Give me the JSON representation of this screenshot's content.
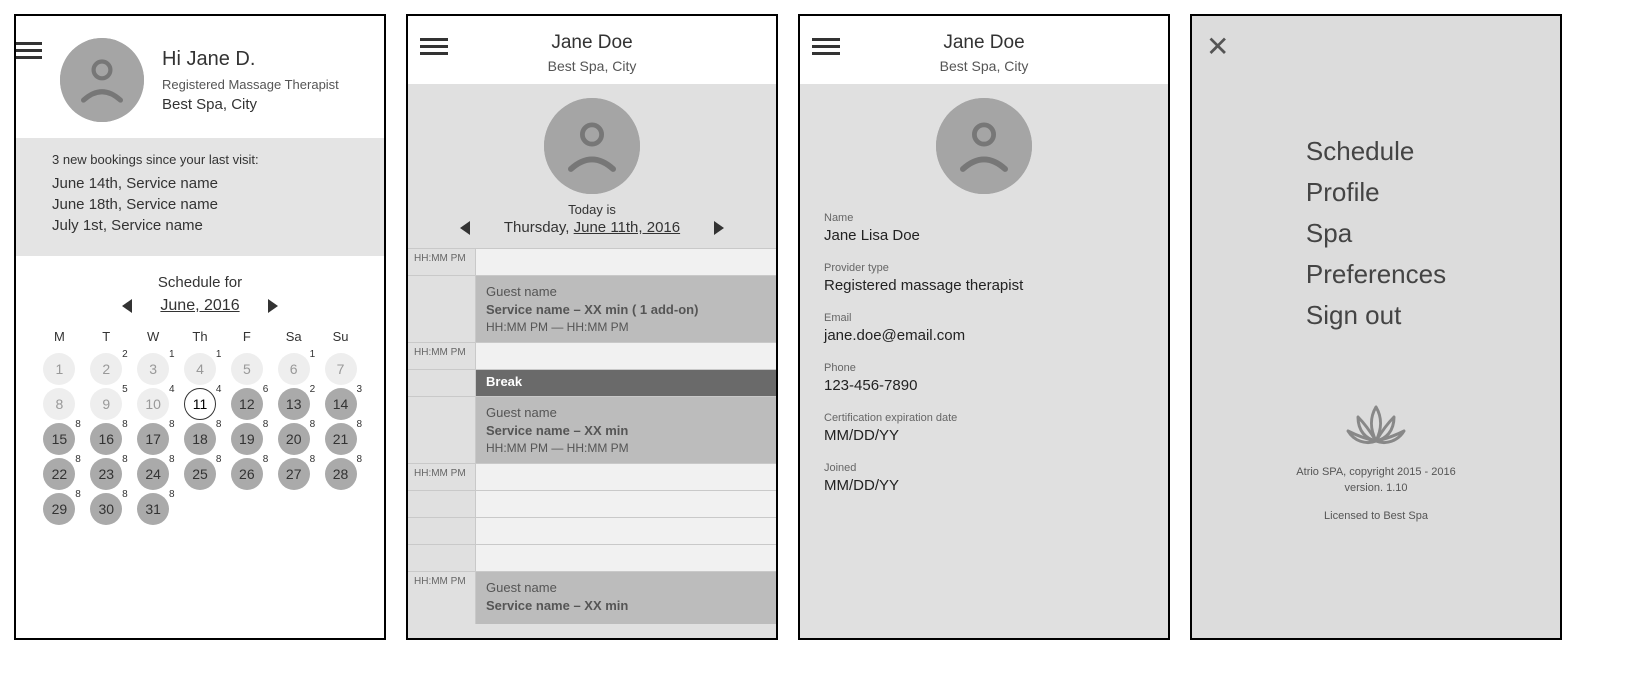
{
  "screen1": {
    "greeting": "Hi Jane D.",
    "role": "Registered Massage Therapist",
    "spa": "Best Spa, City",
    "notif_intro": "3 new bookings since your last visit:",
    "notifs": [
      "June 14th, Service name",
      "June 18th, Service name",
      "July 1st, Service name"
    ],
    "sched_lbl": "Schedule for",
    "sched_date": "June, 2016",
    "dow": [
      "M",
      "T",
      "W",
      "Th",
      "F",
      "Sa",
      "Su"
    ],
    "weeks": [
      [
        {
          "d": "1",
          "t": "light"
        },
        {
          "d": "2",
          "t": "light",
          "b": "2"
        },
        {
          "d": "3",
          "t": "light",
          "b": "1"
        },
        {
          "d": "4",
          "t": "light",
          "b": "1"
        },
        {
          "d": "5",
          "t": "light"
        },
        {
          "d": "6",
          "t": "light",
          "b": "1"
        },
        {
          "d": "7",
          "t": "light"
        }
      ],
      [
        {
          "d": "8",
          "t": "light"
        },
        {
          "d": "9",
          "t": "light",
          "b": "5"
        },
        {
          "d": "10",
          "t": "light",
          "b": "4"
        },
        {
          "d": "11",
          "t": "today",
          "b": "4"
        },
        {
          "d": "12",
          "t": "dark",
          "b": "6"
        },
        {
          "d": "13",
          "t": "dark",
          "b": "2"
        },
        {
          "d": "14",
          "t": "dark",
          "b": "3"
        }
      ],
      [
        {
          "d": "15",
          "t": "dark",
          "b": "8"
        },
        {
          "d": "16",
          "t": "dark",
          "b": "8"
        },
        {
          "d": "17",
          "t": "dark",
          "b": "8"
        },
        {
          "d": "18",
          "t": "dark",
          "b": "8"
        },
        {
          "d": "19",
          "t": "dark",
          "b": "8"
        },
        {
          "d": "20",
          "t": "dark",
          "b": "8"
        },
        {
          "d": "21",
          "t": "dark",
          "b": "8"
        }
      ],
      [
        {
          "d": "22",
          "t": "dark",
          "b": "8"
        },
        {
          "d": "23",
          "t": "dark",
          "b": "8"
        },
        {
          "d": "24",
          "t": "dark",
          "b": "8"
        },
        {
          "d": "25",
          "t": "dark",
          "b": "8"
        },
        {
          "d": "26",
          "t": "dark",
          "b": "8"
        },
        {
          "d": "27",
          "t": "dark",
          "b": "8"
        },
        {
          "d": "28",
          "t": "dark",
          "b": "8"
        }
      ],
      [
        {
          "d": "29",
          "t": "dark",
          "b": "8"
        },
        {
          "d": "30",
          "t": "dark",
          "b": "8"
        },
        {
          "d": "31",
          "t": "dark",
          "b": "8"
        },
        null,
        null,
        null,
        null
      ]
    ]
  },
  "screen2": {
    "name": "Jane Doe",
    "spa": "Best Spa, City",
    "today_lbl": "Today is",
    "date_prefix": "Thursday, ",
    "date_under": "June 11th, 2016",
    "time_placeholder": "HH:MM PM",
    "rows": [
      {
        "time": "HH:MM PM",
        "kind": "empty"
      },
      {
        "time": "",
        "kind": "booking",
        "guest": "Guest name",
        "service": "Service name – XX min ( 1 add-on)",
        "range": "HH:MM PM — HH:MM PM"
      },
      {
        "time": "HH:MM PM",
        "kind": "empty"
      },
      {
        "time": "",
        "kind": "break",
        "label": "Break"
      },
      {
        "time": "",
        "kind": "booking",
        "guest": "Guest name",
        "service": "Service name – XX min",
        "range": "HH:MM PM — HH:MM PM"
      },
      {
        "time": "HH:MM PM",
        "kind": "empty"
      },
      {
        "time": "",
        "kind": "empty"
      },
      {
        "time": "",
        "kind": "empty"
      },
      {
        "time": "",
        "kind": "empty"
      },
      {
        "time": "HH:MM PM",
        "kind": "booking",
        "guest": "Guest name",
        "service": "Service name – XX min",
        "range": ""
      }
    ]
  },
  "screen3": {
    "name": "Jane Doe",
    "spa": "Best Spa, City",
    "fields": [
      {
        "label": "Name",
        "value": "Jane Lisa Doe"
      },
      {
        "label": "Provider type",
        "value": "Registered massage therapist"
      },
      {
        "label": "Email",
        "value": "jane.doe@email.com"
      },
      {
        "label": "Phone",
        "value": "123-456-7890"
      },
      {
        "label": "Certification expiration date",
        "value": "MM/DD/YY"
      },
      {
        "label": "Joined",
        "value": "MM/DD/YY"
      }
    ]
  },
  "screen4": {
    "menu": [
      "Schedule",
      "Profile",
      "Spa",
      "Preferences",
      "Sign out"
    ],
    "copyright": "Atrio SPA, copyright 2015 - 2016",
    "version": "version. 1.10",
    "licensed": "Licensed to Best Spa"
  }
}
